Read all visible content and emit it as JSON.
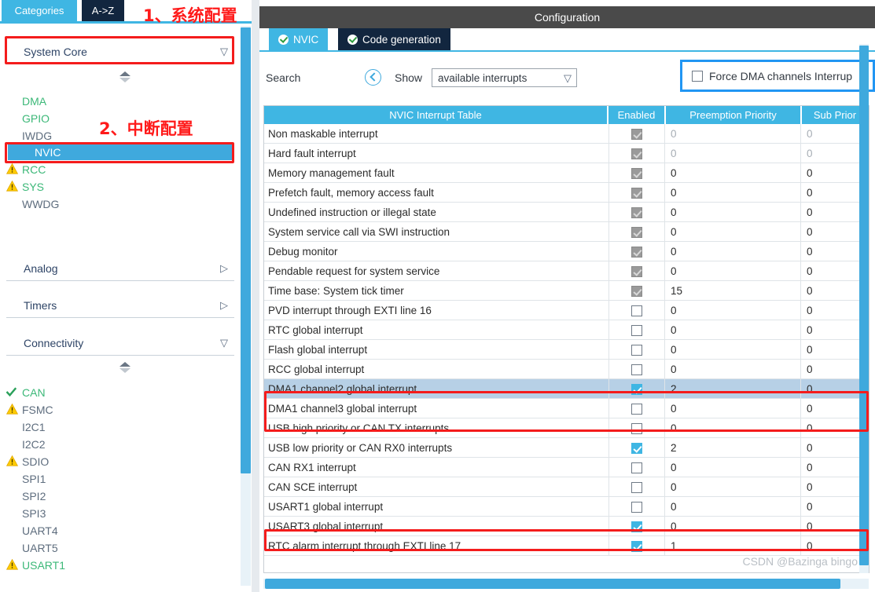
{
  "left_panel": {
    "tabs": [
      {
        "label": "Categories",
        "active": true
      },
      {
        "label": "A->Z",
        "active": false
      }
    ],
    "sections": [
      {
        "label": "System Core",
        "expanded": true,
        "chevron": "chevron-down-icon"
      },
      {
        "label": "Analog",
        "expanded": false,
        "chevron": "chevron-right-icon"
      },
      {
        "label": "Timers",
        "expanded": false,
        "chevron": "chevron-right-icon"
      },
      {
        "label": "Connectivity",
        "expanded": true,
        "chevron": "chevron-down-icon"
      }
    ],
    "system_core_items": [
      {
        "label": "DMA",
        "state": "green",
        "icon": "none"
      },
      {
        "label": "GPIO",
        "state": "green",
        "icon": "none"
      },
      {
        "label": "IWDG",
        "state": "gray",
        "icon": "none"
      },
      {
        "label": "NVIC",
        "state": "selected",
        "icon": "none"
      },
      {
        "label": "RCC",
        "state": "green",
        "icon": "warning-icon"
      },
      {
        "label": "SYS",
        "state": "green",
        "icon": "warning-icon"
      },
      {
        "label": "WWDG",
        "state": "gray",
        "icon": "none"
      }
    ],
    "connectivity_items": [
      {
        "label": "CAN",
        "state": "green",
        "icon": "check-icon"
      },
      {
        "label": "FSMC",
        "state": "gray",
        "icon": "warning-icon"
      },
      {
        "label": "I2C1",
        "state": "gray",
        "icon": "none"
      },
      {
        "label": "I2C2",
        "state": "gray",
        "icon": "none"
      },
      {
        "label": "SDIO",
        "state": "gray",
        "icon": "warning-icon"
      },
      {
        "label": "SPI1",
        "state": "gray",
        "icon": "none"
      },
      {
        "label": "SPI2",
        "state": "gray",
        "icon": "none"
      },
      {
        "label": "SPI3",
        "state": "gray",
        "icon": "none"
      },
      {
        "label": "UART4",
        "state": "gray",
        "icon": "none"
      },
      {
        "label": "UART5",
        "state": "gray",
        "icon": "none"
      },
      {
        "label": "USART1",
        "state": "green",
        "icon": "warning-icon"
      }
    ]
  },
  "right_panel": {
    "title": "Configuration",
    "tabs": [
      {
        "label": "NVIC",
        "active": true,
        "status": "ok"
      },
      {
        "label": "Code generation",
        "active": false,
        "status": "ok"
      }
    ],
    "toolbar": {
      "search_label": "Search",
      "search_icon": "circle-left-arrow-icon",
      "show_label": "Show",
      "show_value": "available interrupts",
      "show_chevron": "chevron-down-icon",
      "force_dma_label": "Force DMA channels Interrup",
      "force_dma_checked": false
    },
    "table": {
      "columns": [
        "NVIC Interrupt Table",
        "Enabled",
        "Preemption Priority",
        "Sub Prior"
      ],
      "rows": [
        {
          "name": "Non maskable interrupt",
          "enabled": true,
          "checkbox_style": "gray",
          "preemption": "0",
          "sub": "0",
          "value_style": "dim",
          "selected": false
        },
        {
          "name": "Hard fault interrupt",
          "enabled": true,
          "checkbox_style": "gray",
          "preemption": "0",
          "sub": "0",
          "value_style": "dim",
          "selected": false
        },
        {
          "name": "Memory management fault",
          "enabled": true,
          "checkbox_style": "gray",
          "preemption": "0",
          "sub": "0",
          "value_style": "norm",
          "selected": false
        },
        {
          "name": "Prefetch fault, memory access fault",
          "enabled": true,
          "checkbox_style": "gray",
          "preemption": "0",
          "sub": "0",
          "value_style": "norm",
          "selected": false
        },
        {
          "name": "Undefined instruction or illegal state",
          "enabled": true,
          "checkbox_style": "gray",
          "preemption": "0",
          "sub": "0",
          "value_style": "norm",
          "selected": false
        },
        {
          "name": "System service call via SWI instruction",
          "enabled": true,
          "checkbox_style": "gray",
          "preemption": "0",
          "sub": "0",
          "value_style": "norm",
          "selected": false
        },
        {
          "name": "Debug monitor",
          "enabled": true,
          "checkbox_style": "gray",
          "preemption": "0",
          "sub": "0",
          "value_style": "norm",
          "selected": false
        },
        {
          "name": "Pendable request for system service",
          "enabled": true,
          "checkbox_style": "gray",
          "preemption": "0",
          "sub": "0",
          "value_style": "norm",
          "selected": false
        },
        {
          "name": "Time base: System tick timer",
          "enabled": true,
          "checkbox_style": "gray",
          "preemption": "15",
          "sub": "0",
          "value_style": "norm",
          "selected": false
        },
        {
          "name": "PVD interrupt through EXTI line 16",
          "enabled": false,
          "checkbox_style": "empty",
          "preemption": "0",
          "sub": "0",
          "value_style": "norm",
          "selected": false
        },
        {
          "name": "RTC global interrupt",
          "enabled": false,
          "checkbox_style": "empty",
          "preemption": "0",
          "sub": "0",
          "value_style": "norm",
          "selected": false
        },
        {
          "name": "Flash global interrupt",
          "enabled": false,
          "checkbox_style": "empty",
          "preemption": "0",
          "sub": "0",
          "value_style": "norm",
          "selected": false
        },
        {
          "name": "RCC global interrupt",
          "enabled": false,
          "checkbox_style": "empty",
          "preemption": "0",
          "sub": "0",
          "value_style": "norm",
          "selected": false
        },
        {
          "name": "DMA1 channel2 global interrupt",
          "enabled": true,
          "checkbox_style": "blue",
          "preemption": "2",
          "sub": "0",
          "value_style": "norm",
          "selected": true
        },
        {
          "name": "DMA1 channel3 global interrupt",
          "enabled": false,
          "checkbox_style": "empty",
          "preemption": "0",
          "sub": "0",
          "value_style": "norm",
          "selected": false
        },
        {
          "name": "USB high priority or CAN TX interrupts",
          "enabled": false,
          "checkbox_style": "empty",
          "preemption": "0",
          "sub": "0",
          "value_style": "norm",
          "selected": false
        },
        {
          "name": "USB low priority or CAN RX0 interrupts",
          "enabled": true,
          "checkbox_style": "blue",
          "preemption": "2",
          "sub": "0",
          "value_style": "norm",
          "selected": false
        },
        {
          "name": "CAN RX1 interrupt",
          "enabled": false,
          "checkbox_style": "empty",
          "preemption": "0",
          "sub": "0",
          "value_style": "norm",
          "selected": false
        },
        {
          "name": "CAN SCE interrupt",
          "enabled": false,
          "checkbox_style": "empty",
          "preemption": "0",
          "sub": "0",
          "value_style": "norm",
          "selected": false
        },
        {
          "name": "USART1 global interrupt",
          "enabled": false,
          "checkbox_style": "empty",
          "preemption": "0",
          "sub": "0",
          "value_style": "norm",
          "selected": false
        },
        {
          "name": "USART3 global interrupt",
          "enabled": true,
          "checkbox_style": "blue",
          "preemption": "0",
          "sub": "0",
          "value_style": "norm",
          "selected": false
        },
        {
          "name": "RTC alarm interrupt through EXTI line 17",
          "enabled": true,
          "checkbox_style": "blue",
          "preemption": "1",
          "sub": "0",
          "value_style": "norm",
          "selected": false
        }
      ]
    },
    "watermark": "CSDN @Bazinga bingo"
  },
  "annotations": {
    "step1_text": "1、系统配置",
    "step2_text": "2、中断配置",
    "red_color": "#f41c1c",
    "blue_color": "#2196f3"
  }
}
